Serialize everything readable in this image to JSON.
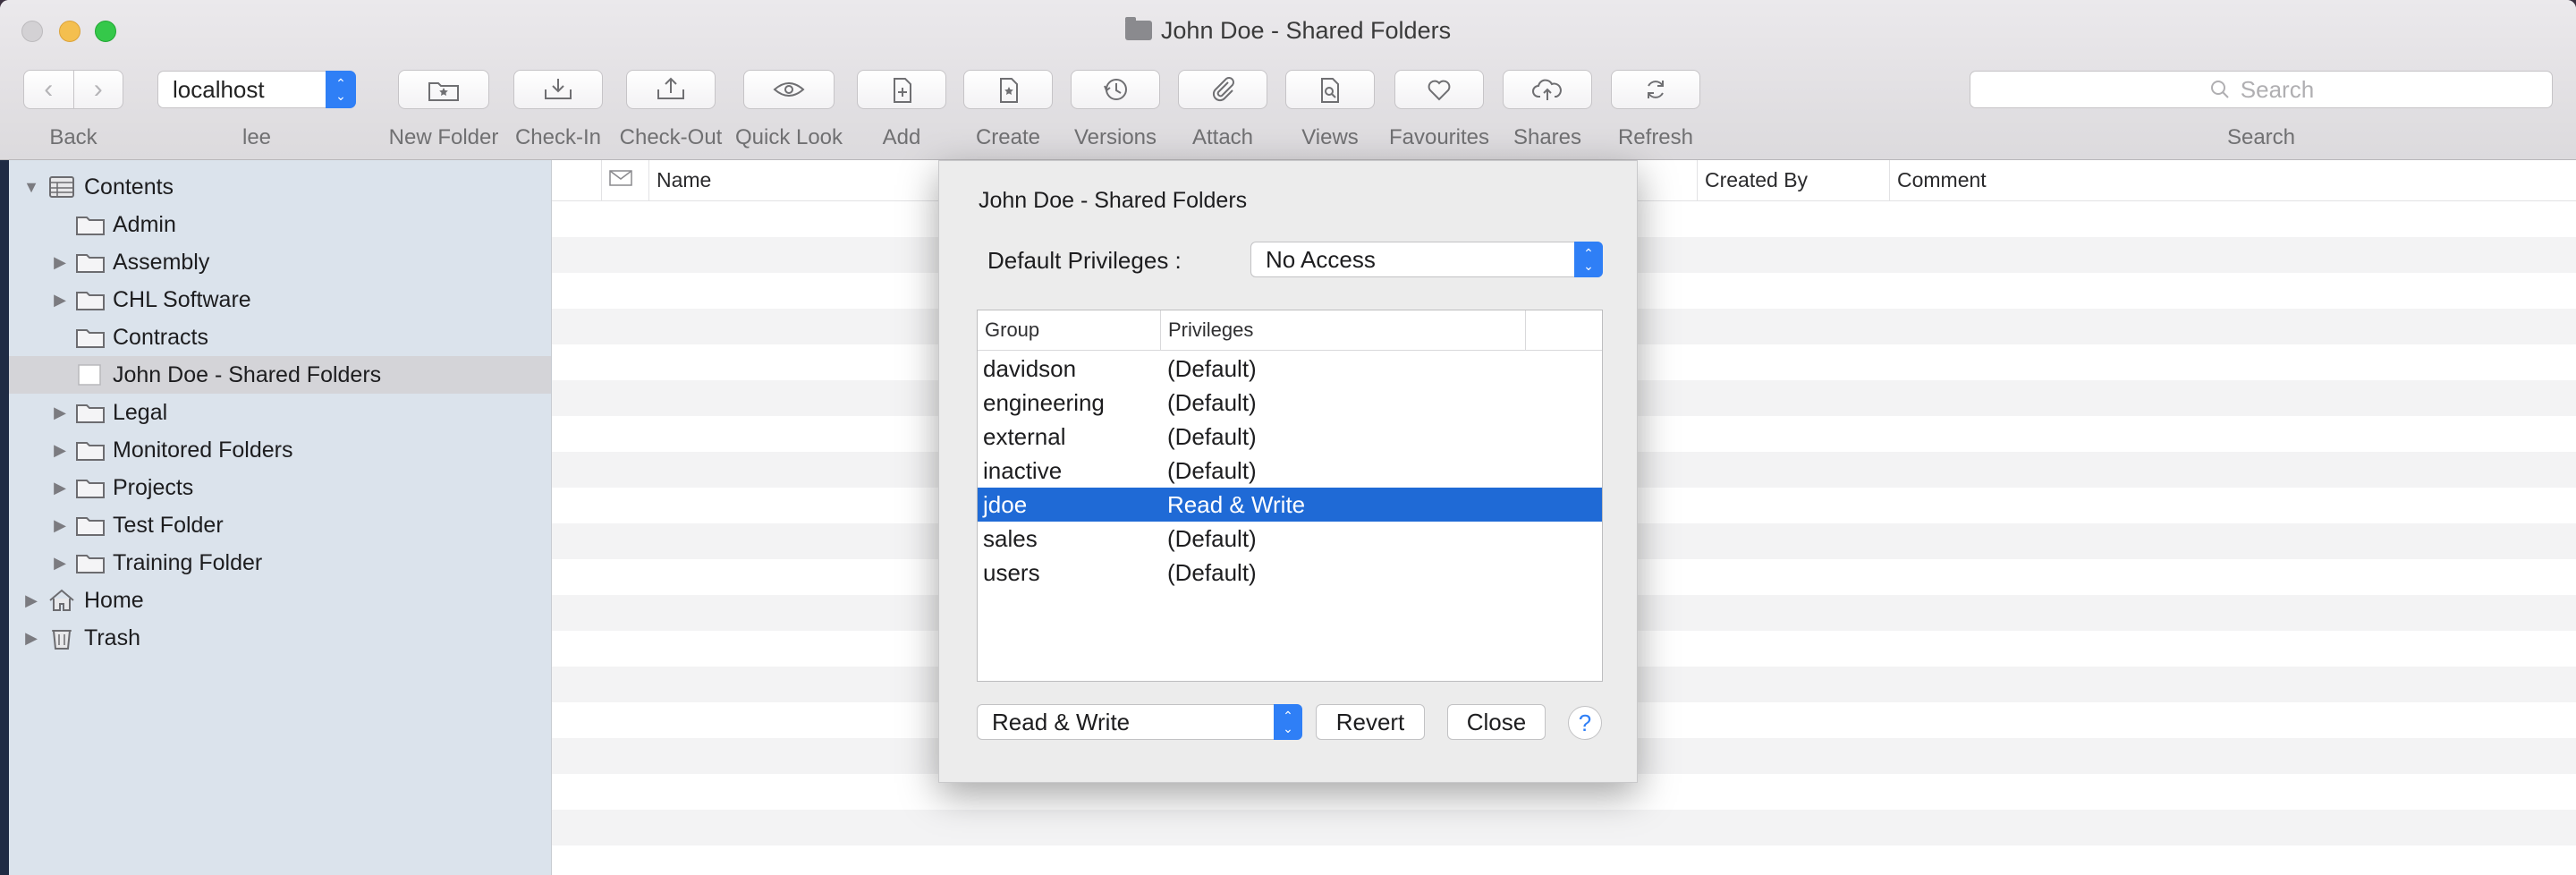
{
  "window": {
    "title": "John Doe - Shared Folders"
  },
  "toolbar": {
    "server": "localhost",
    "search_placeholder": "Search",
    "labels": {
      "back": "Back",
      "user": "lee",
      "new_folder": "New Folder",
      "check_in": "Check-In",
      "check_out": "Check-Out",
      "quick_look": "Quick Look",
      "add": "Add",
      "create": "Create",
      "versions": "Versions",
      "attach": "Attach",
      "views": "Views",
      "favourites": "Favourites",
      "shares": "Shares",
      "refresh": "Refresh",
      "search": "Search"
    }
  },
  "sidebar": {
    "items": [
      {
        "label": "Contents",
        "icon": "contents-icon"
      },
      {
        "label": "Admin",
        "icon": "folder-icon"
      },
      {
        "label": "Assembly",
        "icon": "folder-icon"
      },
      {
        "label": "CHL Software",
        "icon": "folder-icon"
      },
      {
        "label": "Contracts",
        "icon": "folder-icon"
      },
      {
        "label": "John Doe - Shared Folders",
        "icon": "shared-folder-icon",
        "selected": true
      },
      {
        "label": "Legal",
        "icon": "folder-icon"
      },
      {
        "label": "Monitored Folders",
        "icon": "folder-icon"
      },
      {
        "label": "Projects",
        "icon": "folder-icon"
      },
      {
        "label": "Test Folder",
        "icon": "folder-icon"
      },
      {
        "label": "Training Folder",
        "icon": "folder-icon"
      },
      {
        "label": "Home",
        "icon": "home-icon"
      },
      {
        "label": "Trash",
        "icon": "trash-icon"
      }
    ]
  },
  "list": {
    "columns": {
      "name": "Name",
      "created_by": "Created By",
      "comment": "Comment"
    }
  },
  "dialog": {
    "title": "John Doe - Shared Folders",
    "default_privileges_label": "Default Privileges :",
    "default_privileges_value": "No Access",
    "table_headers": {
      "group": "Group",
      "privileges": "Privileges"
    },
    "rows": [
      {
        "group": "davidson",
        "privilege": "(Default)"
      },
      {
        "group": "engineering",
        "privilege": "(Default)"
      },
      {
        "group": "external",
        "privilege": "(Default)"
      },
      {
        "group": "inactive",
        "privilege": "(Default)"
      },
      {
        "group": "jdoe",
        "privilege": "Read & Write",
        "selected": true
      },
      {
        "group": "sales",
        "privilege": "(Default)"
      },
      {
        "group": "users",
        "privilege": "(Default)"
      }
    ],
    "selected_privilege": "Read & Write",
    "revert_label": "Revert",
    "close_label": "Close",
    "help_label": "?"
  },
  "colors": {
    "accent": "#2f7ff6",
    "selection": "#1f6ad6"
  }
}
